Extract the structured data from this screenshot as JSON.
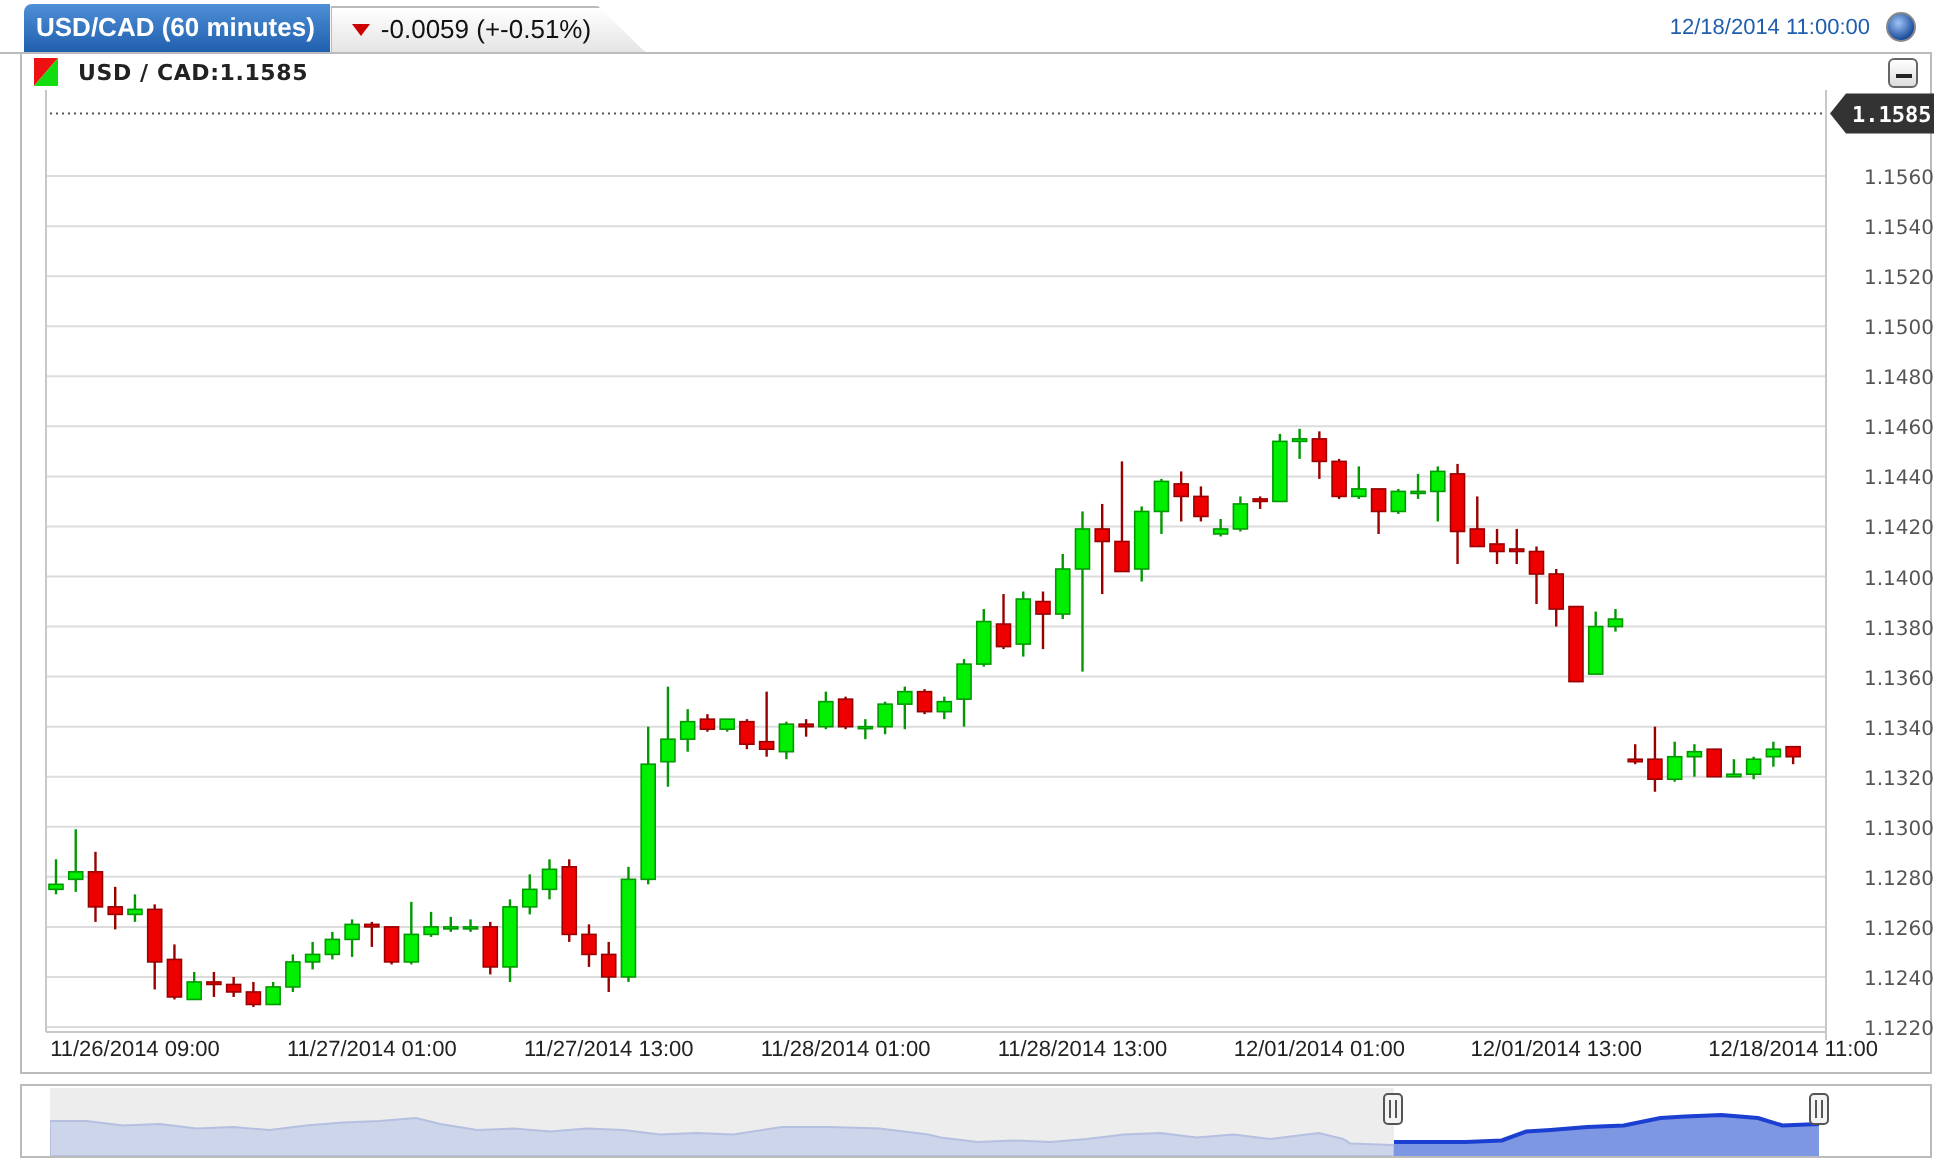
{
  "header": {
    "symbol_tab": "USD/CAD (60 minutes)",
    "change": {
      "falling": true,
      "text": "-0.0059 (+-0.51%)"
    },
    "timestamp": "12/18/2014 11:00:00"
  },
  "panel": {
    "title": "USD / CAD:1.1585",
    "chart": {
      "chart_data": {
        "type": "candlestick",
        "grid": true,
        "ylim": [
          1.1218,
          1.1592
        ],
        "ref_lines": [
          {
            "axis": "y",
            "value": 1.1585,
            "label": "1.1585"
          }
        ],
        "yticks": [
          {
            "value": 1.122,
            "label": "1.1220"
          },
          {
            "value": 1.124,
            "label": "1.1240"
          },
          {
            "value": 1.126,
            "label": "1.1260"
          },
          {
            "value": 1.128,
            "label": "1.1280"
          },
          {
            "value": 1.13,
            "label": "1.1300"
          },
          {
            "value": 1.132,
            "label": "1.1320"
          },
          {
            "value": 1.134,
            "label": "1.1340"
          },
          {
            "value": 1.136,
            "label": "1.1360"
          },
          {
            "value": 1.138,
            "label": "1.1380"
          },
          {
            "value": 1.14,
            "label": "1.1400"
          },
          {
            "value": 1.142,
            "label": "1.1420"
          },
          {
            "value": 1.144,
            "label": "1.1440"
          },
          {
            "value": 1.146,
            "label": "1.1460"
          },
          {
            "value": 1.148,
            "label": "1.1480"
          },
          {
            "value": 1.15,
            "label": "1.1500"
          },
          {
            "value": 1.152,
            "label": "1.1520"
          },
          {
            "value": 1.154,
            "label": "1.1540"
          },
          {
            "value": 1.156,
            "label": "1.1560"
          }
        ],
        "categories": [
          null,
          null,
          null,
          null,
          "11/26/2014 09:00",
          null,
          null,
          null,
          null,
          null,
          null,
          null,
          null,
          null,
          null,
          null,
          "11/27/2014 01:00",
          null,
          null,
          null,
          null,
          null,
          null,
          null,
          null,
          null,
          null,
          null,
          "11/27/2014 13:00",
          null,
          null,
          null,
          null,
          null,
          null,
          null,
          null,
          null,
          null,
          null,
          "11/28/2014 01:00",
          null,
          null,
          null,
          null,
          null,
          null,
          null,
          null,
          null,
          null,
          null,
          "11/28/2014 13:00",
          null,
          null,
          null,
          null,
          null,
          null,
          null,
          null,
          null,
          null,
          null,
          "12/01/2014 01:00",
          null,
          null,
          null,
          null,
          null,
          null,
          null,
          null,
          null,
          null,
          null,
          "12/01/2014 13:00",
          null,
          null,
          null,
          null,
          null,
          null,
          null,
          null,
          null,
          null,
          null,
          "12/18/2014 11:00"
        ],
        "ohlc": [
          [
            1.1275,
            1.1287,
            1.1273,
            1.1277
          ],
          [
            1.1279,
            1.1299,
            1.1274,
            1.1282
          ],
          [
            1.1282,
            1.129,
            1.1262,
            1.1268
          ],
          [
            1.1268,
            1.1276,
            1.1259,
            1.1265
          ],
          [
            1.1265,
            1.1273,
            1.1262,
            1.1267
          ],
          [
            1.1267,
            1.1269,
            1.1235,
            1.1246
          ],
          [
            1.1247,
            1.1253,
            1.1231,
            1.1232
          ],
          [
            1.1231,
            1.1242,
            1.1231,
            1.1238
          ],
          [
            1.1238,
            1.1242,
            1.1232,
            1.1237
          ],
          [
            1.1237,
            1.124,
            1.1232,
            1.1234
          ],
          [
            1.1234,
            1.1238,
            1.1228,
            1.1229
          ],
          [
            1.1229,
            1.1238,
            1.1229,
            1.1236
          ],
          [
            1.1236,
            1.1249,
            1.1234,
            1.1246
          ],
          [
            1.1246,
            1.1254,
            1.1243,
            1.1249
          ],
          [
            1.1249,
            1.1258,
            1.1247,
            1.1255
          ],
          [
            1.1255,
            1.1263,
            1.1248,
            1.1261
          ],
          [
            1.1261,
            1.1262,
            1.1252,
            1.126
          ],
          [
            1.126,
            1.126,
            1.1245,
            1.1246
          ],
          [
            1.1246,
            1.127,
            1.1245,
            1.1257
          ],
          [
            1.1257,
            1.1266,
            1.1256,
            1.126
          ],
          [
            1.126,
            1.1264,
            1.1258,
            1.126
          ],
          [
            1.126,
            1.1263,
            1.1258,
            1.126
          ],
          [
            1.126,
            1.1262,
            1.1241,
            1.1244
          ],
          [
            1.1244,
            1.1271,
            1.1238,
            1.1268
          ],
          [
            1.1268,
            1.1281,
            1.1265,
            1.1275
          ],
          [
            1.1275,
            1.1287,
            1.1271,
            1.1283
          ],
          [
            1.1284,
            1.1287,
            1.1254,
            1.1257
          ],
          [
            1.1257,
            1.1261,
            1.1244,
            1.1249
          ],
          [
            1.1249,
            1.1254,
            1.1234,
            1.124
          ],
          [
            1.124,
            1.1284,
            1.1238,
            1.1279
          ],
          [
            1.1279,
            1.134,
            1.1277,
            1.1325
          ],
          [
            1.1326,
            1.1356,
            1.1316,
            1.1335
          ],
          [
            1.1335,
            1.1347,
            1.133,
            1.1342
          ],
          [
            1.1343,
            1.1345,
            1.1338,
            1.1339
          ],
          [
            1.1339,
            1.1343,
            1.1338,
            1.1343
          ],
          [
            1.1342,
            1.1343,
            1.1331,
            1.1333
          ],
          [
            1.1334,
            1.1354,
            1.1328,
            1.1331
          ],
          [
            1.133,
            1.1342,
            1.1327,
            1.1341
          ],
          [
            1.1341,
            1.1343,
            1.1336,
            1.134
          ],
          [
            1.134,
            1.1354,
            1.1339,
            1.135
          ],
          [
            1.1351,
            1.1352,
            1.1339,
            1.134
          ],
          [
            1.134,
            1.1343,
            1.1335,
            1.134
          ],
          [
            1.134,
            1.135,
            1.1337,
            1.1349
          ],
          [
            1.1349,
            1.1356,
            1.1339,
            1.1354
          ],
          [
            1.1354,
            1.1355,
            1.1345,
            1.1346
          ],
          [
            1.1346,
            1.1352,
            1.1343,
            1.135
          ],
          [
            1.1351,
            1.1367,
            1.134,
            1.1365
          ],
          [
            1.1365,
            1.1387,
            1.1364,
            1.1382
          ],
          [
            1.1381,
            1.1393,
            1.1371,
            1.1372
          ],
          [
            1.1373,
            1.1394,
            1.1368,
            1.1391
          ],
          [
            1.139,
            1.1394,
            1.1371,
            1.1385
          ],
          [
            1.1385,
            1.1409,
            1.1383,
            1.1403
          ],
          [
            1.1403,
            1.1426,
            1.1362,
            1.1419
          ],
          [
            1.1419,
            1.1429,
            1.1393,
            1.1414
          ],
          [
            1.1414,
            1.1446,
            1.1402,
            1.1402
          ],
          [
            1.1403,
            1.1428,
            1.1398,
            1.1426
          ],
          [
            1.1426,
            1.1439,
            1.1417,
            1.1438
          ],
          [
            1.1437,
            1.1442,
            1.1422,
            1.1432
          ],
          [
            1.1432,
            1.1436,
            1.1422,
            1.1424
          ],
          [
            1.1417,
            1.1423,
            1.1416,
            1.1419
          ],
          [
            1.1419,
            1.1432,
            1.1418,
            1.1429
          ],
          [
            1.1431,
            1.1432,
            1.1427,
            1.143
          ],
          [
            1.143,
            1.1457,
            1.143,
            1.1454
          ],
          [
            1.1454,
            1.1459,
            1.1447,
            1.1455
          ],
          [
            1.1455,
            1.1458,
            1.1439,
            1.1446
          ],
          [
            1.1446,
            1.1447,
            1.1431,
            1.1432
          ],
          [
            1.1432,
            1.1444,
            1.1431,
            1.1435
          ],
          [
            1.1435,
            1.1435,
            1.1417,
            1.1426
          ],
          [
            1.1426,
            1.1435,
            1.1425,
            1.1434
          ],
          [
            1.1434,
            1.1441,
            1.1431,
            1.1434
          ],
          [
            1.1434,
            1.1444,
            1.1422,
            1.1442
          ],
          [
            1.1441,
            1.1445,
            1.1405,
            1.1418
          ],
          [
            1.1419,
            1.1432,
            1.1412,
            1.1412
          ],
          [
            1.1413,
            1.1419,
            1.1405,
            1.141
          ],
          [
            1.1411,
            1.1419,
            1.1405,
            1.141
          ],
          [
            1.141,
            1.1412,
            1.1389,
            1.1401
          ],
          [
            1.1401,
            1.1403,
            1.138,
            1.1387
          ],
          [
            1.1388,
            1.1388,
            1.1358,
            1.1358
          ],
          [
            1.1361,
            1.1386,
            1.1361,
            1.138
          ],
          [
            1.138,
            1.1387,
            1.1378,
            1.1383
          ],
          [
            1.1327,
            1.1333,
            1.1325,
            1.1326
          ],
          [
            1.1327,
            1.134,
            1.1314,
            1.1319
          ],
          [
            1.1319,
            1.1334,
            1.1318,
            1.1328
          ],
          [
            1.1328,
            1.1333,
            1.132,
            1.133
          ],
          [
            1.1331,
            1.1331,
            1.132,
            1.132
          ],
          [
            1.132,
            1.1327,
            1.132,
            1.1321
          ],
          [
            1.1321,
            1.1328,
            1.1319,
            1.1327
          ],
          [
            1.1328,
            1.1334,
            1.1324,
            1.1331
          ],
          [
            1.1332,
            1.1332,
            1.1325,
            1.1328
          ]
        ]
      }
    }
  }
}
